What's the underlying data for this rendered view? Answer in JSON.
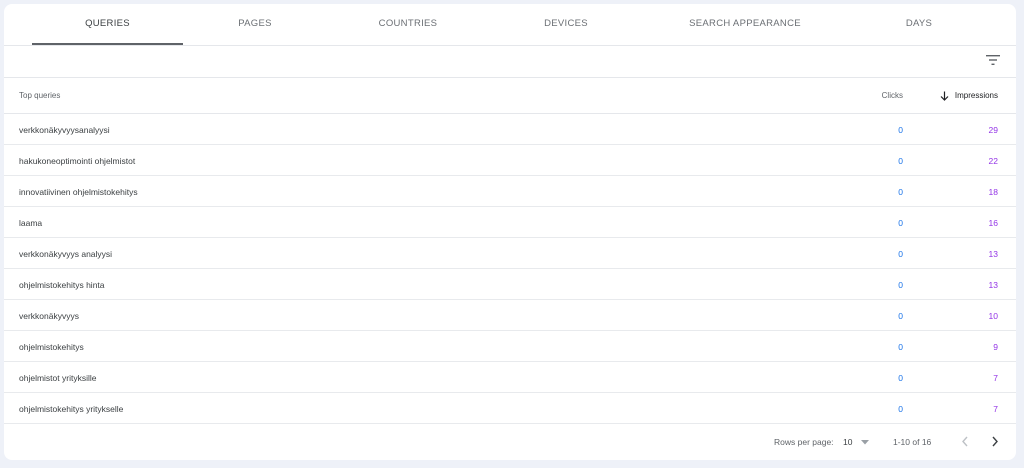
{
  "tabs": [
    {
      "label": "QUERIES",
      "active": true
    },
    {
      "label": "PAGES"
    },
    {
      "label": "COUNTRIES"
    },
    {
      "label": "DEVICES"
    },
    {
      "label": "SEARCH APPEARANCE"
    },
    {
      "label": "DAYS"
    }
  ],
  "table": {
    "headers": {
      "query": "Top queries",
      "clicks": "Clicks",
      "impressions": "Impressions"
    },
    "sort": {
      "column": "impressions",
      "direction": "descending"
    },
    "rows": [
      {
        "query": "verkkonäkyvyysanalyysi",
        "clicks": "0",
        "impressions": "29"
      },
      {
        "query": "hakukoneoptimointi ohjelmistot",
        "clicks": "0",
        "impressions": "22"
      },
      {
        "query": "innovatiivinen ohjelmistokehitys",
        "clicks": "0",
        "impressions": "18"
      },
      {
        "query": "laama",
        "clicks": "0",
        "impressions": "16"
      },
      {
        "query": "verkkonäkyvyys analyysi",
        "clicks": "0",
        "impressions": "13"
      },
      {
        "query": "ohjelmistokehitys hinta",
        "clicks": "0",
        "impressions": "13"
      },
      {
        "query": "verkkonäkyvyys",
        "clicks": "0",
        "impressions": "10"
      },
      {
        "query": "ohjelmistokehitys",
        "clicks": "0",
        "impressions": "9"
      },
      {
        "query": "ohjelmistot yrityksille",
        "clicks": "0",
        "impressions": "7"
      },
      {
        "query": "ohjelmistokehitys yritykselle",
        "clicks": "0",
        "impressions": "7"
      }
    ]
  },
  "pagination": {
    "rows_per_page_label": "Rows per page:",
    "rows_per_page": "10",
    "range": "1-10 of 16"
  },
  "colors": {
    "clicks": "#1a73e8",
    "impressions": "#9334e6",
    "active_tab_underline": "#5f6368"
  },
  "icons": {
    "filter": "filter-icon",
    "sort": "arrow-down-icon",
    "prev": "chevron-left-icon",
    "next": "chevron-right-icon"
  }
}
